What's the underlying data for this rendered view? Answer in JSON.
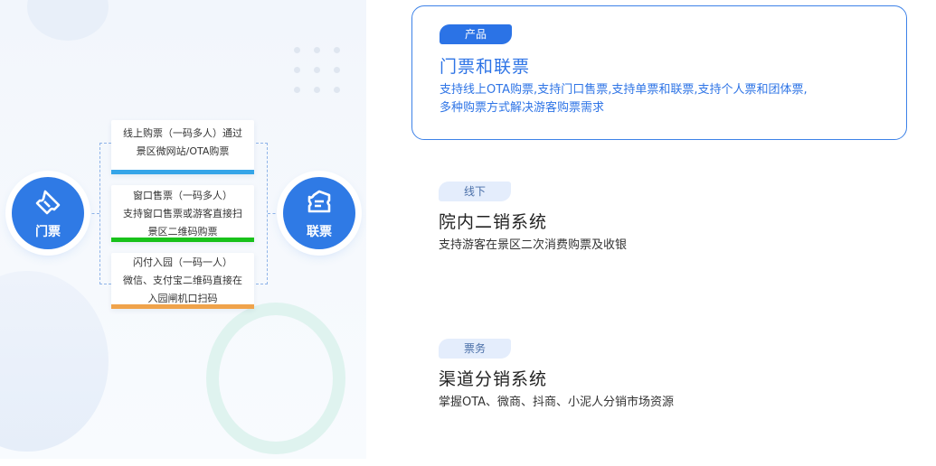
{
  "diagram": {
    "left_circle_label": "门票",
    "right_circle_label": "联票",
    "cards": [
      {
        "lines": [
          "线上购票（一码多人）通过",
          "景区微网站/OTA购票"
        ]
      },
      {
        "lines": [
          "窗口售票（一码多人）",
          "支持窗口售票或游客直接扫",
          "景区二维码购票"
        ]
      },
      {
        "lines": [
          "闪付入园（一码一人）",
          "微信、支付宝二维码直接在",
          "入园闸机口扫码"
        ]
      }
    ]
  },
  "features": [
    {
      "tag": "产品",
      "title": "门票和联票",
      "desc_lines": [
        "支持线上OTA购票,支持门口售票,支持单票和联票,支持个人票和团体票,",
        "多种购票方式解决游客购票需求"
      ]
    },
    {
      "tag": "线下",
      "title": "院内二销系统",
      "desc_lines": [
        "支持游客在景区二次消费购票及收银"
      ]
    },
    {
      "tag": "票务",
      "title": "渠道分销系统",
      "desc_lines": [
        "掌握OTA、微商、抖商、小泥人分销市场资源"
      ]
    }
  ],
  "colors": {
    "accent_blue": "#2f7ae5",
    "card_bar_1": "#35a5e8",
    "card_bar_2": "#19c21b",
    "card_bar_3": "#f0a34b"
  },
  "icons": {
    "left_circle": "ticket-icon",
    "right_circle": "combo-ticket-icon"
  }
}
